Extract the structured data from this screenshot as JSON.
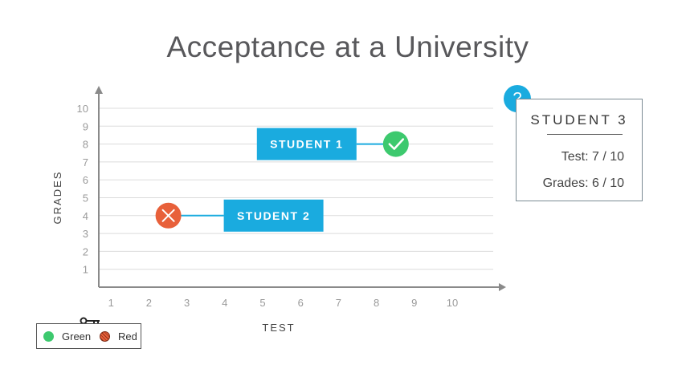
{
  "chart_data": {
    "type": "scatter",
    "title": "Acceptance at a University",
    "xlabel": "TEST",
    "ylabel": "GRADES",
    "xlim": [
      0,
      10
    ],
    "ylim": [
      0,
      10
    ],
    "x_ticks": [
      "1",
      "2",
      "3",
      "4",
      "5",
      "6",
      "7",
      "8",
      "9",
      "10"
    ],
    "y_ticks": [
      "1",
      "2",
      "3",
      "4",
      "5",
      "6",
      "7",
      "8",
      "9",
      "10"
    ],
    "grid": true,
    "points": [
      {
        "label": "STUDENT 1",
        "x": 9,
        "y": 8,
        "status": "accepted"
      },
      {
        "label": "STUDENT 2",
        "x": 3,
        "y": 4,
        "status": "rejected"
      }
    ],
    "legend": [
      {
        "name": "Green",
        "color": "#3dc96e"
      },
      {
        "name": "Red",
        "color": "#e8603a"
      }
    ],
    "legend_placement": "bottom-left"
  },
  "student_card": {
    "title": "STUDENT 3",
    "test_line": "Test: 7 / 10",
    "grades_line": "Grades: 6 / 10",
    "badge": "?"
  },
  "colors": {
    "accent": "#1aabdf",
    "accepted": "#3dc96e",
    "rejected": "#e8603a",
    "grid": "#dcdcdc",
    "axis": "#8a8a8a"
  },
  "icons": {
    "accepted": "checkmark-icon",
    "rejected": "x-mark-icon",
    "legend_key": "key-icon"
  }
}
